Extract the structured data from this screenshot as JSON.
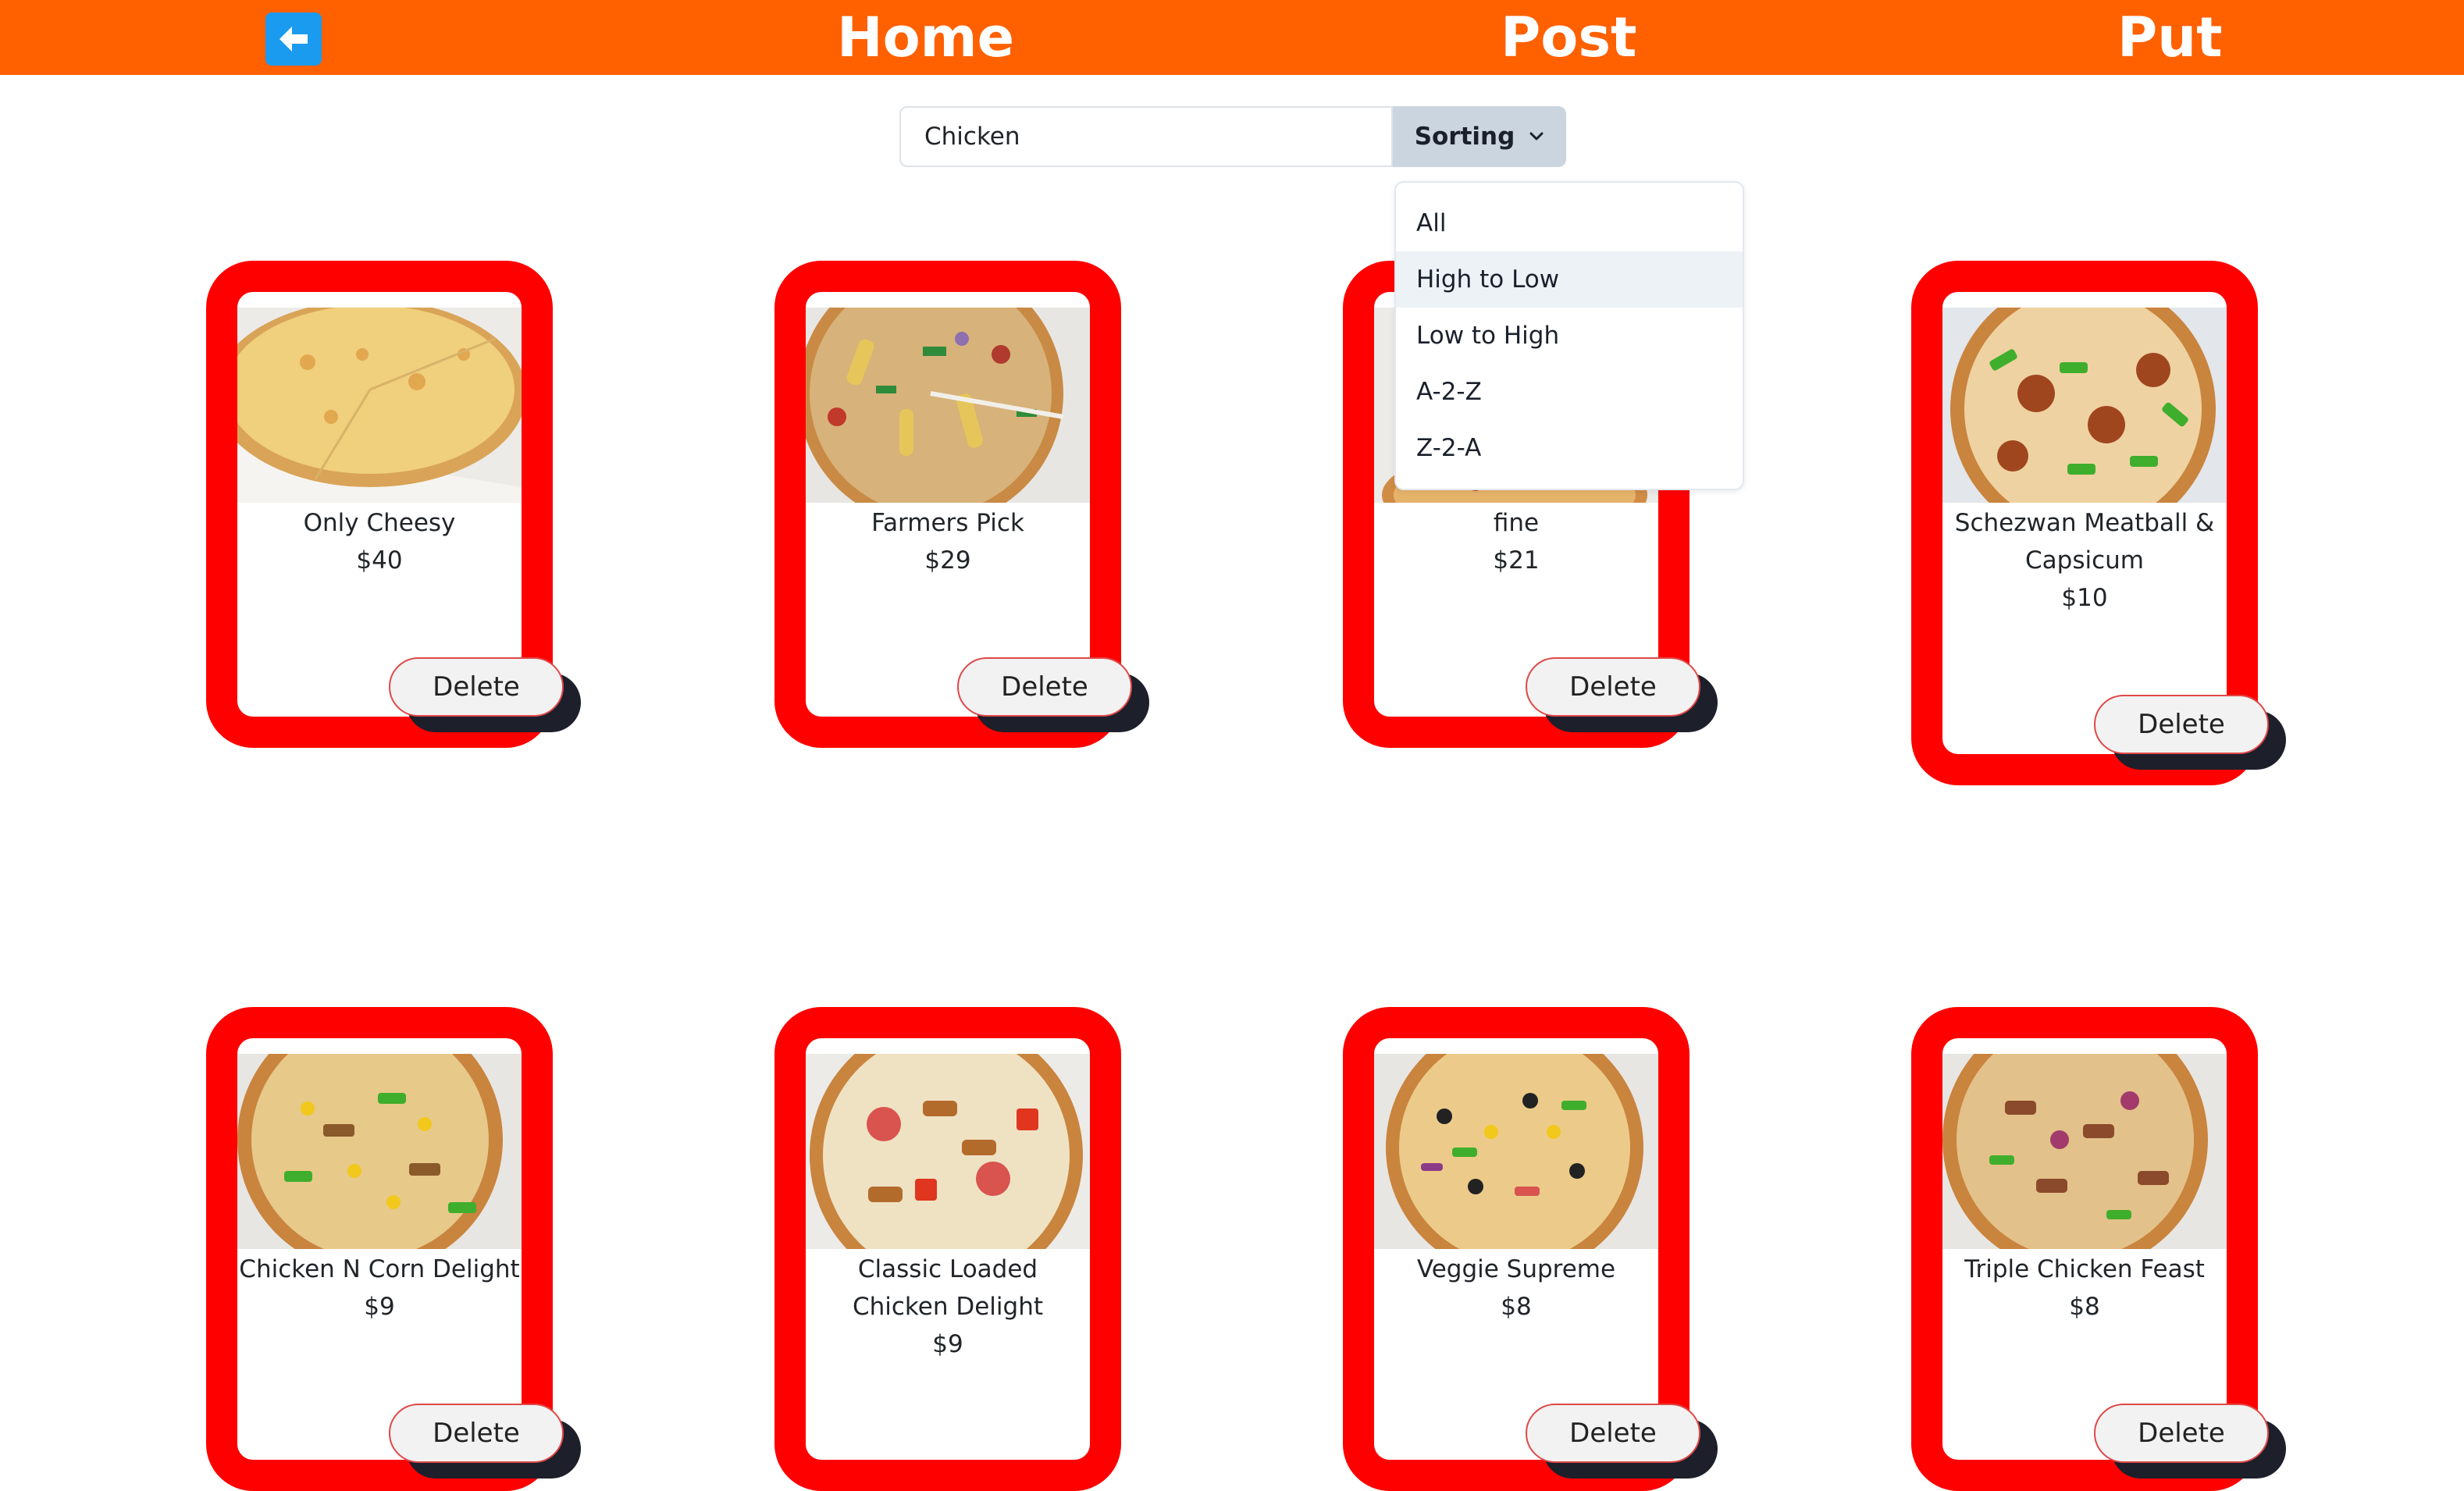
{
  "navbar": {
    "back_icon": "arrow-left-icon",
    "links": [
      "Home",
      "Post",
      "Put"
    ]
  },
  "search": {
    "value": "Chicken",
    "placeholder": ""
  },
  "sorting": {
    "label": "Sorting",
    "options": [
      "All",
      "High to Low",
      "Low to High",
      "A-2-Z",
      "Z-2-A"
    ],
    "highlighted": "High to Low"
  },
  "products": [
    {
      "name": "Only Cheesy",
      "price": "$40",
      "delete_label": "Delete"
    },
    {
      "name": "Farmers Pick",
      "price": "$29",
      "delete_label": "Delete"
    },
    {
      "name": "fine",
      "price": "$21",
      "delete_label": "Delete"
    },
    {
      "name": "Schezwan Meatball & Capsicum",
      "price": "$10",
      "delete_label": "Delete"
    },
    {
      "name": "Chicken N Corn Delight",
      "price": "$9",
      "delete_label": "Delete"
    },
    {
      "name": "Classic Loaded Chicken Delight",
      "price": "$9",
      "delete_label": "Delete"
    },
    {
      "name": "Veggie Supreme",
      "price": "$8",
      "delete_label": "Delete"
    },
    {
      "name": "Triple Chicken Feast",
      "price": "$8",
      "delete_label": "Delete"
    }
  ],
  "colors": {
    "navbar": "#ff6000",
    "card_border": "#ff0000",
    "back_button": "#1b9bf0",
    "sort_button": "#cbd5e0"
  }
}
